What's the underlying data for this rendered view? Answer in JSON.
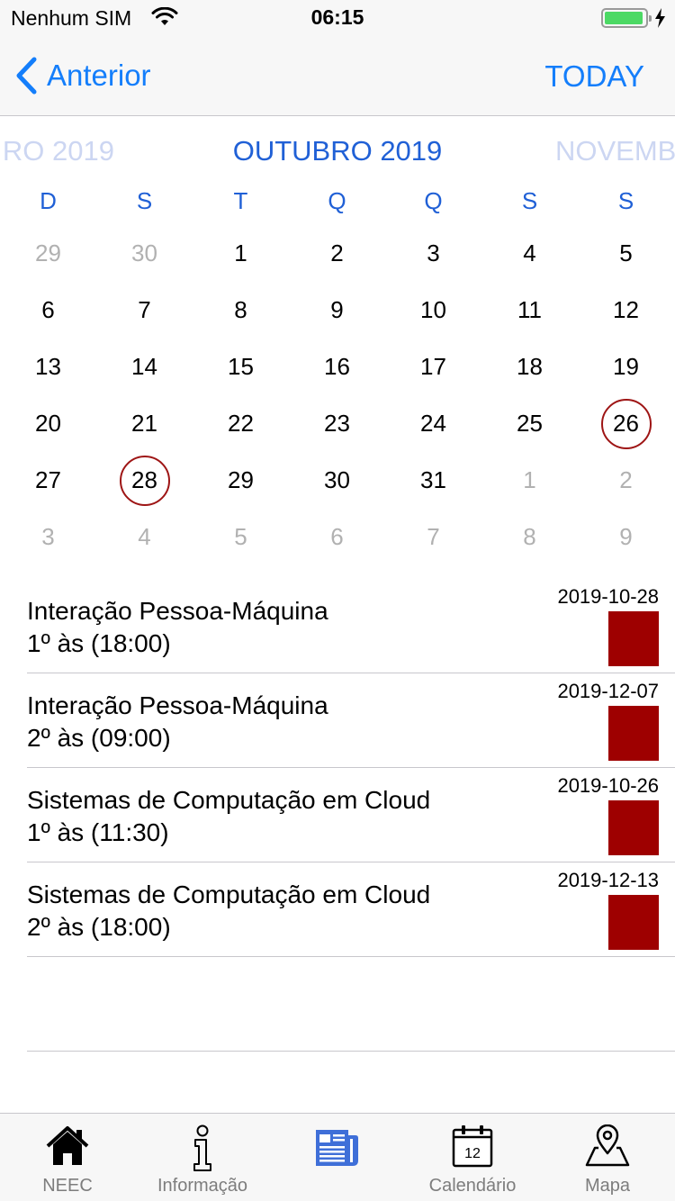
{
  "status_bar": {
    "carrier": "Nenhum SIM",
    "time": "06:15"
  },
  "nav": {
    "back_label": "Anterior",
    "today_label": "TODAY"
  },
  "calendar": {
    "prev_month": "RO 2019",
    "current_month": "OUTUBRO 2019",
    "next_month": "NOVEMB",
    "weekdays": [
      "D",
      "S",
      "T",
      "Q",
      "Q",
      "S",
      "S"
    ],
    "weeks": [
      [
        {
          "d": "29",
          "o": true
        },
        {
          "d": "30",
          "o": true
        },
        {
          "d": "1"
        },
        {
          "d": "2"
        },
        {
          "d": "3"
        },
        {
          "d": "4"
        },
        {
          "d": "5"
        }
      ],
      [
        {
          "d": "6"
        },
        {
          "d": "7"
        },
        {
          "d": "8"
        },
        {
          "d": "9"
        },
        {
          "d": "10"
        },
        {
          "d": "11"
        },
        {
          "d": "12"
        }
      ],
      [
        {
          "d": "13"
        },
        {
          "d": "14"
        },
        {
          "d": "15"
        },
        {
          "d": "16"
        },
        {
          "d": "17"
        },
        {
          "d": "18"
        },
        {
          "d": "19"
        }
      ],
      [
        {
          "d": "20"
        },
        {
          "d": "21"
        },
        {
          "d": "22"
        },
        {
          "d": "23"
        },
        {
          "d": "24"
        },
        {
          "d": "25"
        },
        {
          "d": "26",
          "m": true
        }
      ],
      [
        {
          "d": "27"
        },
        {
          "d": "28",
          "m": true
        },
        {
          "d": "29"
        },
        {
          "d": "30"
        },
        {
          "d": "31"
        },
        {
          "d": "1",
          "o": true
        },
        {
          "d": "2",
          "o": true
        }
      ],
      [
        {
          "d": "3",
          "o": true
        },
        {
          "d": "4",
          "o": true
        },
        {
          "d": "5",
          "o": true
        },
        {
          "d": "6",
          "o": true
        },
        {
          "d": "7",
          "o": true
        },
        {
          "d": "8",
          "o": true
        },
        {
          "d": "9",
          "o": true
        }
      ]
    ]
  },
  "events": [
    {
      "title": "Interação Pessoa-Máquina",
      "time": "1º às (18:00)",
      "date": "2019-10-28",
      "color": "#9e0000"
    },
    {
      "title": "Interação Pessoa-Máquina",
      "time": "2º às (09:00)",
      "date": "2019-12-07",
      "color": "#9e0000"
    },
    {
      "title": "Sistemas de Computação em Cloud",
      "time": "1º às (11:30)",
      "date": "2019-10-26",
      "color": "#9e0000"
    },
    {
      "title": "Sistemas de Computação em Cloud",
      "time": "2º às (18:00)",
      "date": "2019-12-13",
      "color": "#9e0000"
    }
  ],
  "tabs": [
    {
      "label": "NEEC",
      "icon": "home-icon"
    },
    {
      "label": "Informação",
      "icon": "info-icon"
    },
    {
      "label": "",
      "icon": "newspaper-icon",
      "active": true
    },
    {
      "label": "Calendário",
      "icon": "calendar-icon",
      "badge": "12"
    },
    {
      "label": "Mapa",
      "icon": "map-pin-icon"
    }
  ],
  "colors": {
    "accent": "#147efb",
    "calendar_blue": "#2060d6",
    "marker": "#9e1515",
    "event_swatch": "#9e0000"
  }
}
